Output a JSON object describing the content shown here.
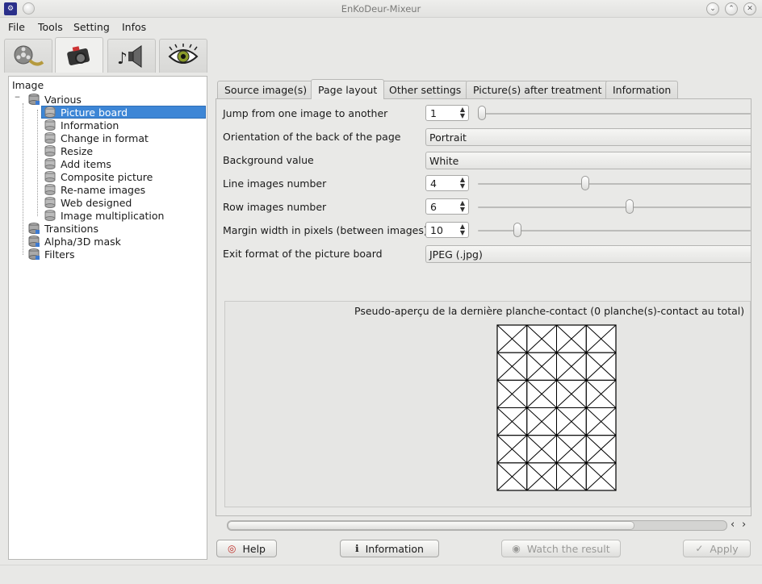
{
  "window": {
    "title": "EnKoDeur-Mixeur"
  },
  "menu": {
    "items": [
      "File",
      "Tools",
      "Setting",
      "Infos"
    ]
  },
  "toolbar_tabs": [
    {
      "icon": "film-reel-icon"
    },
    {
      "icon": "camera-icon"
    },
    {
      "icon": "speaker-icon"
    },
    {
      "icon": "eye-icon"
    }
  ],
  "tree": {
    "header": "Image",
    "root": "Various",
    "children": [
      "Picture board",
      "Information",
      "Change in format",
      "Resize",
      "Add items",
      "Composite picture",
      "Re-name images",
      "Web designed",
      "Image multiplication"
    ],
    "siblings": [
      "Transitions",
      "Alpha/3D mask",
      "Filters"
    ],
    "selected": "Picture board"
  },
  "tabs": [
    "Source image(s)",
    "Page layout",
    "Other settings",
    "Picture(s) after treatment",
    "Information"
  ],
  "active_tab": "Page layout",
  "settings": {
    "jump": {
      "label": "Jump from one image to another",
      "value": "1",
      "level": 0.0
    },
    "orientation": {
      "label": "Orientation of the back of the page",
      "value": "Portrait"
    },
    "background": {
      "label": "Background value",
      "value": "White"
    },
    "line_images": {
      "label": "Line images number",
      "value": "4",
      "level": 0.38
    },
    "row_images": {
      "label": "Row images number",
      "value": "6",
      "level": 0.54
    },
    "margin": {
      "label": "Margin width in pixels (between images)",
      "value": "10",
      "level": 0.13
    },
    "exit_format": {
      "label": "Exit format of the picture board",
      "value": "JPEG (.jpg)"
    }
  },
  "preview": {
    "title": "Pseudo-aperçu de la dernière planche-contact (0 planche(s)-contact au total)",
    "columns": 4,
    "rows": 6
  },
  "buttons": {
    "help": "Help",
    "information": "Information",
    "watch": "Watch the result",
    "apply": "Apply"
  }
}
